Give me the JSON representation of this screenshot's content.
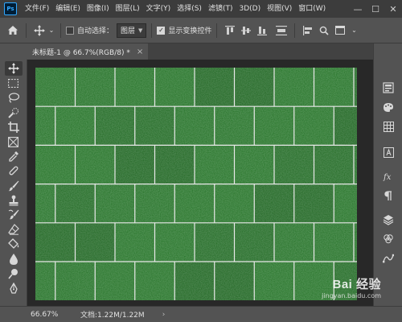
{
  "app": {
    "logo_text": "Ps"
  },
  "menu": [
    "文件(F)",
    "编辑(E)",
    "图像(I)",
    "图层(L)",
    "文字(Y)",
    "选择(S)",
    "滤镜(T)",
    "3D(D)",
    "视图(V)",
    "窗口(W)"
  ],
  "window_controls": {
    "minimize": "—",
    "maximize": "☐",
    "close": "✕"
  },
  "options": {
    "auto_select_label": "自动选择：",
    "auto_select_checked": false,
    "layer_select_value": "图层",
    "show_transform_label": "显示变换控件",
    "show_transform_checked": true
  },
  "document": {
    "tab_title": "未标题-1 @ 66.7%(RGB/8) *",
    "close": "×"
  },
  "status": {
    "zoom": "66.67%",
    "doc_info": "文档:1.22M/1.22M",
    "arrow": "›"
  },
  "watermark": {
    "main": "Bai 经验",
    "sub": "jingyan.baidu.com"
  },
  "tools": [
    "move-tool",
    "marquee-tool",
    "lasso-tool",
    "quick-select-tool",
    "crop-tool",
    "frame-tool",
    "eyedropper-tool",
    "healing-brush-tool",
    "brush-tool",
    "clone-stamp-tool",
    "history-brush-tool",
    "eraser-tool",
    "paint-bucket-tool",
    "blur-tool",
    "dodge-tool",
    "pen-tool"
  ],
  "colors": {
    "grass": "#1f5d20",
    "grout": "#e8e8e8",
    "canvas_bg": "#282828"
  }
}
